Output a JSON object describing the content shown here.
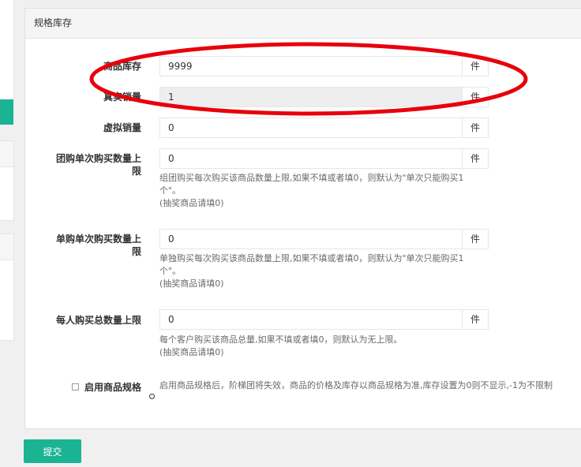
{
  "panel": {
    "title": "规格库存"
  },
  "fields": {
    "stock": {
      "label": "商品库存",
      "value": "9999",
      "unit": "件"
    },
    "real_sales": {
      "label": "真实销量",
      "value": "1",
      "unit": "件"
    },
    "virtual_sales": {
      "label": "虚拟销量",
      "value": "0",
      "unit": "件"
    },
    "group_limit": {
      "label_line1": "团购单次购买数量上",
      "label_line2": "限",
      "value": "0",
      "unit": "件",
      "help_line1": "组团购买每次购买该商品数量上限,如果不填或者填0，则默认为\"单次只能购买1",
      "help_line2": "个\"。",
      "help_line3": "(抽奖商品请填0)"
    },
    "single_limit": {
      "label_line1": "单购单次购买数量上",
      "label_line2": "限",
      "value": "0",
      "unit": "件",
      "help_line1": "单独购买每次购买该商品数量上限,如果不填或者填0，则默认为\"单次只能购买1",
      "help_line2": "个\"。",
      "help_line3": "(抽奖商品请填0)"
    },
    "total_limit": {
      "label": "每人购买总数量上限",
      "value": "0",
      "unit": "件",
      "help_line1": "每个客户购买该商品总量,如果不填或者填0，则默认为无上限。",
      "help_line2": "(抽奖商品请填0)"
    }
  },
  "spec_option": {
    "label": "启用商品规格",
    "help": "启用商品规格后，阶梯团将失效，商品的价格及库存以商品规格为准,库存设置为0则不显示,-1为不限制",
    "checked": false
  },
  "submit_label": "提交",
  "annotation_color": "#e8000b"
}
